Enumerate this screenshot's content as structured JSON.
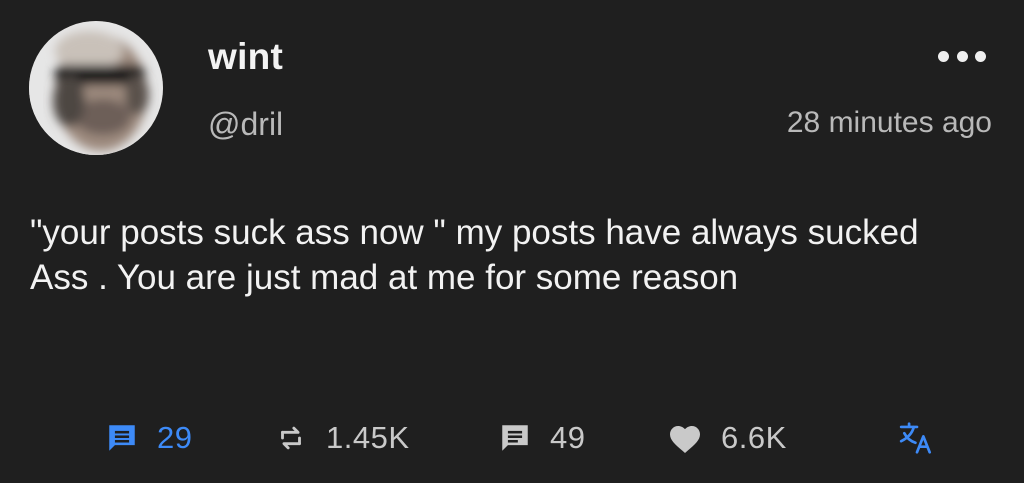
{
  "post": {
    "author": {
      "display_name": "wint",
      "handle": "@dril",
      "avatar": "blurred-portrait-with-sunglasses"
    },
    "timestamp": "28 minutes ago",
    "text": "\"your posts suck ass now \" my posts have always sucked Ass . You are just mad at me for some reason",
    "more_icon": "more-horizontal-icon"
  },
  "actions": {
    "replies": {
      "icon": "reply-thread-icon",
      "count": "29",
      "color": "#3d8af7"
    },
    "reposts": {
      "icon": "repost-icon",
      "count": "1.45K"
    },
    "quotes": {
      "icon": "comment-icon",
      "count": "49"
    },
    "likes": {
      "icon": "heart-icon",
      "count": "6.6K"
    },
    "translate": {
      "icon": "translate-icon",
      "color": "#3d8af7"
    }
  },
  "colors": {
    "background": "#1f1f1f",
    "text_primary": "#f2f2f2",
    "text_secondary": "#b9b9b9",
    "accent": "#3d8af7"
  }
}
